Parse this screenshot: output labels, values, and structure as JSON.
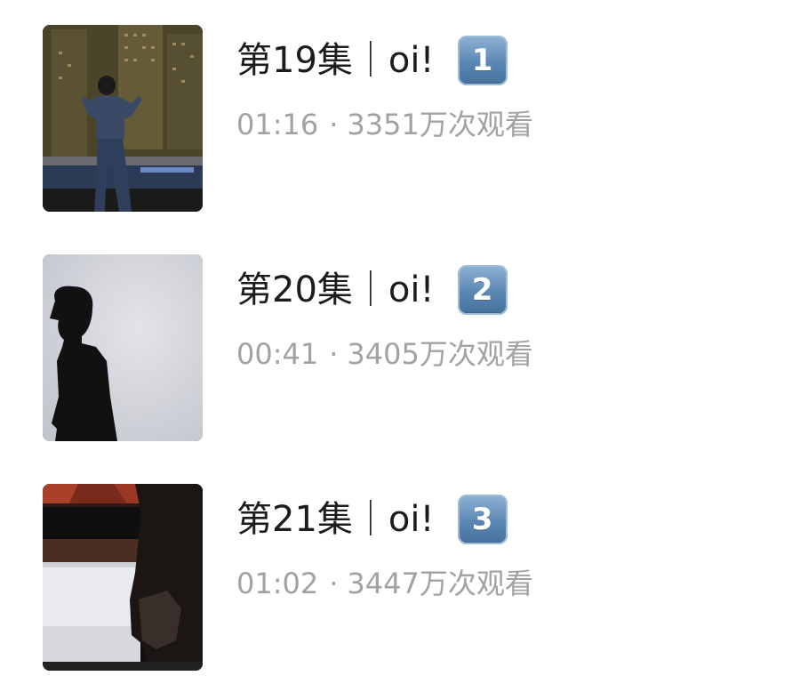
{
  "episodes": [
    {
      "title": "第19集｜oi!",
      "badge": "1",
      "duration": "01:16",
      "separator": "·",
      "views": "3351万次观看",
      "thumbnail": "night-city-dancer"
    },
    {
      "title": "第20集｜oi!",
      "badge": "2",
      "duration": "00:41",
      "separator": "·",
      "views": "3405万次观看",
      "thumbnail": "silhouette-shadow"
    },
    {
      "title": "第21集｜oi!",
      "badge": "3",
      "duration": "01:02",
      "separator": "·",
      "views": "3447万次观看",
      "thumbnail": "dark-studio"
    }
  ],
  "colors": {
    "title": "#1c1c1c",
    "meta": "#a2a2a2",
    "badge": "#5c87b3"
  }
}
